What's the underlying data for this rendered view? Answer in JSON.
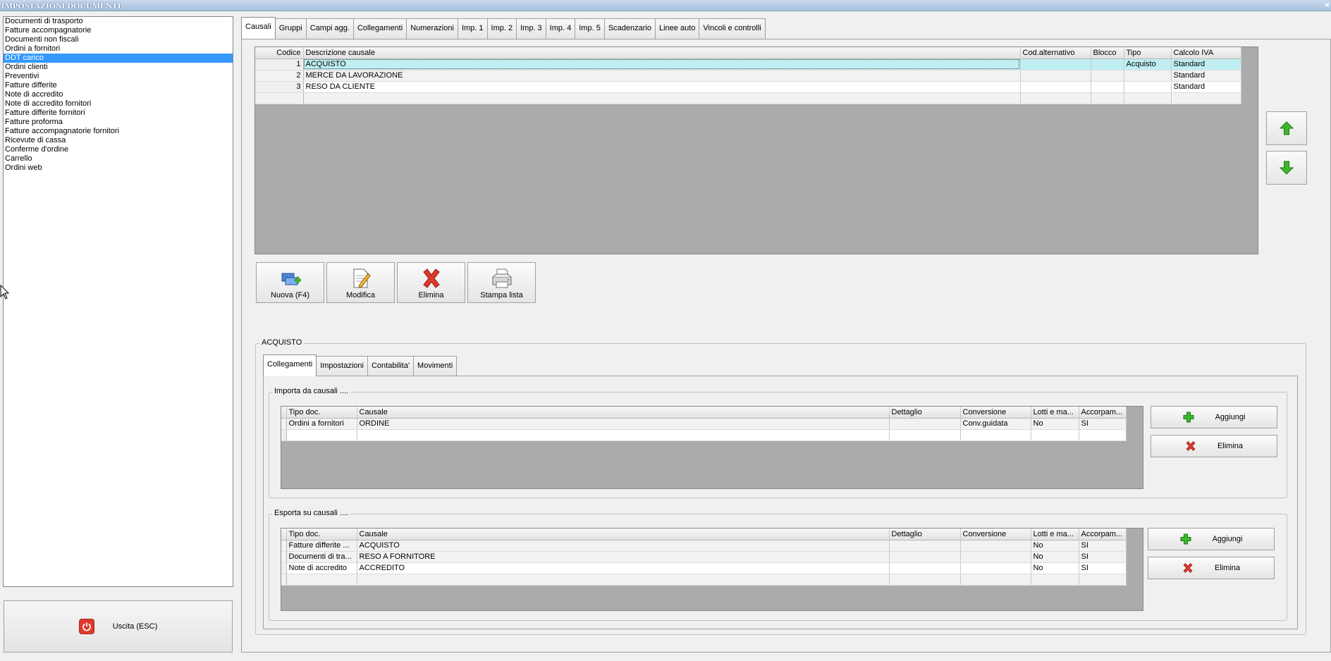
{
  "window": {
    "title": "IMPOSTAZIONI DOCUMENTI",
    "close": "×"
  },
  "doc_types": [
    {
      "label": "Documenti di trasporto",
      "selected": false
    },
    {
      "label": "Fatture accompagnatorie",
      "selected": false
    },
    {
      "label": "Documenti non fiscali",
      "selected": false
    },
    {
      "label": "Ordini a fornitori",
      "selected": false
    },
    {
      "label": "DDT carico",
      "selected": true
    },
    {
      "label": "Ordini clienti",
      "selected": false
    },
    {
      "label": "Preventivi",
      "selected": false
    },
    {
      "label": "Fatture differite",
      "selected": false
    },
    {
      "label": "Note di accredito",
      "selected": false
    },
    {
      "label": "Note di accredito fornitori",
      "selected": false
    },
    {
      "label": "Fatture differite fornitori",
      "selected": false
    },
    {
      "label": "Fatture proforma",
      "selected": false
    },
    {
      "label": "Fatture accompagnatorie fornitori",
      "selected": false
    },
    {
      "label": "Ricevute di cassa",
      "selected": false
    },
    {
      "label": "Conferme d'ordine",
      "selected": false
    },
    {
      "label": "Carrello",
      "selected": false
    },
    {
      "label": "Ordini web",
      "selected": false
    }
  ],
  "exit_button": {
    "label": "Uscita (ESC)"
  },
  "main_tabs": [
    {
      "label": "Causali",
      "active": true
    },
    {
      "label": "Gruppi",
      "active": false
    },
    {
      "label": "Campi agg.",
      "active": false
    },
    {
      "label": "Collegamenti",
      "active": false
    },
    {
      "label": "Numerazioni",
      "active": false
    },
    {
      "label": "Imp. 1",
      "active": false
    },
    {
      "label": "Imp. 2",
      "active": false
    },
    {
      "label": "Imp. 3",
      "active": false
    },
    {
      "label": "Imp. 4",
      "active": false
    },
    {
      "label": "Imp. 5",
      "active": false
    },
    {
      "label": "Scadenzario",
      "active": false
    },
    {
      "label": "Linee auto",
      "active": false
    },
    {
      "label": "Vincoli e controlli",
      "active": false
    }
  ],
  "causali_grid": {
    "columns": [
      "Codice",
      "Descrizione causale",
      "Cod.alternativo",
      "Blocco",
      "Tipo",
      "Calcolo IVA"
    ],
    "rows": [
      {
        "codice": "1",
        "descrizione": "ACQUISTO",
        "cod_alt": "",
        "blocco": "",
        "tipo": "Acquisto",
        "calcolo_iva": "Standard",
        "selected": true
      },
      {
        "codice": "2",
        "descrizione": "MERCE DA LAVORAZIONE",
        "cod_alt": "",
        "blocco": "",
        "tipo": "",
        "calcolo_iva": "Standard",
        "selected": false
      },
      {
        "codice": "3",
        "descrizione": "RESO DA CLIENTE",
        "cod_alt": "",
        "blocco": "",
        "tipo": "",
        "calcolo_iva": "Standard",
        "selected": false
      }
    ]
  },
  "toolbar": {
    "new_label": "Nuova (F4)",
    "edit_label": "Modifica",
    "delete_label": "Elimina",
    "print_label": "Stampa lista"
  },
  "detail": {
    "title": "ACQUISTO",
    "tabs": [
      {
        "label": "Collegamenti",
        "active": true
      },
      {
        "label": "Impostazioni",
        "active": false
      },
      {
        "label": "Contabilita'",
        "active": false
      },
      {
        "label": "Movimenti",
        "active": false
      }
    ],
    "import_group": {
      "title": "Importa da causali ....",
      "columns": [
        "Tipo doc.",
        "Causale",
        "Dettaglio",
        "Conversione",
        "Lotti e ma...",
        "Accorpam..."
      ],
      "rows": [
        {
          "tipo_doc": "Ordini a fornitori",
          "causale": "ORDINE",
          "dettaglio": "",
          "conversione": "Conv.guidata",
          "lotti": "No",
          "accorpam": "SI"
        }
      ],
      "add_label": "Aggiungi",
      "delete_label": "Elimina"
    },
    "export_group": {
      "title": "Esporta su causali ....",
      "columns": [
        "Tipo doc.",
        "Causale",
        "Dettaglio",
        "Conversione",
        "Lotti e ma...",
        "Accorpam..."
      ],
      "rows": [
        {
          "tipo_doc": "Fatture differite ...",
          "causale": "ACQUISTO",
          "dettaglio": "",
          "conversione": "",
          "lotti": "No",
          "accorpam": "SI"
        },
        {
          "tipo_doc": "Documenti di tra...",
          "causale": "RESO A FORNITORE",
          "dettaglio": "",
          "conversione": "",
          "lotti": "No",
          "accorpam": "SI"
        },
        {
          "tipo_doc": "Note di accredito",
          "causale": "ACCREDITO",
          "dettaglio": "",
          "conversione": "",
          "lotti": "No",
          "accorpam": "SI"
        }
      ],
      "add_label": "Aggiungi",
      "delete_label": "Elimina"
    }
  },
  "colors": {
    "selection": "#3399ff",
    "row_highlight": "#bfeff2",
    "grid_bg": "#ababab",
    "arrow_green": "#3cb82e",
    "delete_red": "#e0382b"
  }
}
